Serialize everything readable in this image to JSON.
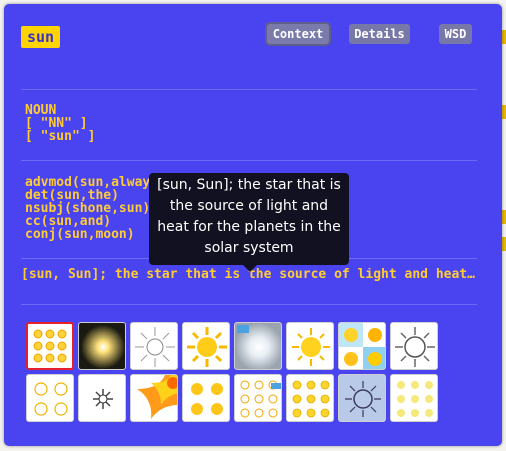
{
  "word": "sun",
  "tabs": [
    {
      "label": "Context"
    },
    {
      "label": "Details"
    },
    {
      "label": "WSD"
    }
  ],
  "pos": {
    "label": "NOUN",
    "tags": [
      "[ \"NN\" ]",
      "[ \"sun\" ]"
    ]
  },
  "dependencies": [
    "advmod(sun,always)",
    "det(sun,the)",
    "nsubj(shone,sun)",
    "cc(sun,and)",
    "conj(sun,moon)"
  ],
  "tooltip": "[sun, Sun]; the star that is the source of light and heat for the planets in the solar system",
  "gloss": "[sun, Sun]; the star that is the source of light and heat for the planets in the solar system",
  "images": {
    "row1": [
      "sun-icons-grid",
      "sun-glow-dark",
      "sun-rays-sketch",
      "sun-cartoon-yellow",
      "sun-flare-photo",
      "sun-cartoon-yellow-2",
      "sun-icons-collage",
      "sun-rays-outline"
    ],
    "row2": [
      "sun-icons-outline",
      "sun-starburst-gray",
      "sun-flame-orange",
      "sun-icons-set",
      "sun-icons-doodle",
      "sun-icons-mixed",
      "sun-outline-blue",
      "sun-icons-pale"
    ]
  },
  "colors": {
    "panel": "#4a44f0",
    "accent": "#ffcc33",
    "badge": "#ffd400",
    "selected_border": "#e5202a"
  }
}
